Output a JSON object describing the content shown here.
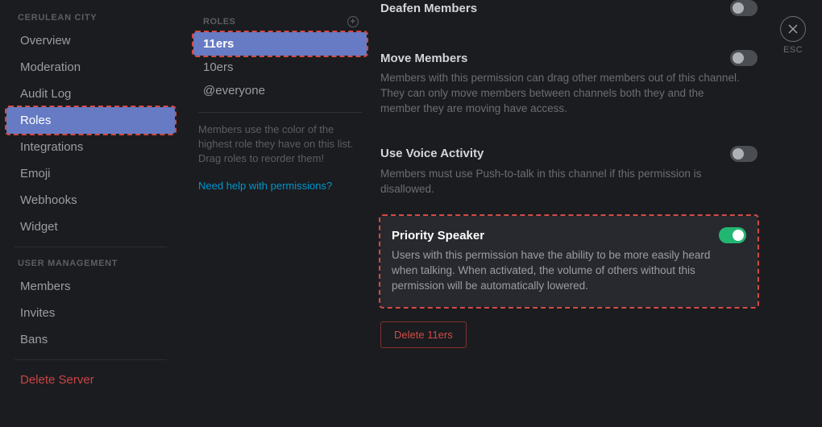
{
  "server": {
    "name": "CERULEAN CITY"
  },
  "sidebar": {
    "groups": [
      {
        "items": [
          {
            "label": "Overview",
            "name": "overview"
          },
          {
            "label": "Moderation",
            "name": "moderation"
          },
          {
            "label": "Audit Log",
            "name": "audit-log"
          },
          {
            "label": "Roles",
            "name": "roles",
            "active": true
          },
          {
            "label": "Integrations",
            "name": "integrations"
          },
          {
            "label": "Emoji",
            "name": "emoji"
          },
          {
            "label": "Webhooks",
            "name": "webhooks"
          },
          {
            "label": "Widget",
            "name": "widget"
          }
        ]
      },
      {
        "heading": "USER MANAGEMENT",
        "items": [
          {
            "label": "Members",
            "name": "members"
          },
          {
            "label": "Invites",
            "name": "invites"
          },
          {
            "label": "Bans",
            "name": "bans"
          }
        ]
      }
    ],
    "delete_server": "Delete Server"
  },
  "roles": {
    "heading": "ROLES",
    "items": [
      {
        "label": "11ers",
        "active": true
      },
      {
        "label": "10ers"
      },
      {
        "label": "@everyone"
      }
    ],
    "hint": "Members use the color of the highest role they have on this list. Drag roles to reorder them!",
    "help_link": "Need help with permissions?"
  },
  "permissions": [
    {
      "key": "deafen",
      "title": "Deafen Members",
      "enabled": false
    },
    {
      "key": "move",
      "title": "Move Members",
      "enabled": false,
      "desc": "Members with this permission can drag other members out of this channel. They can only move members between channels both they and the member they are moving have access."
    },
    {
      "key": "voice_activity",
      "title": "Use Voice Activity",
      "enabled": false,
      "desc": "Members must use Push-to-talk in this channel if this permission is disallowed."
    },
    {
      "key": "priority",
      "title": "Priority Speaker",
      "enabled": true,
      "desc": "Users with this permission have the ability to be more easily heard when talking. When activated, the volume of others without this permission will be automatically lowered."
    }
  ],
  "delete_role_label": "Delete 11ers",
  "esc": {
    "label": "ESC"
  }
}
